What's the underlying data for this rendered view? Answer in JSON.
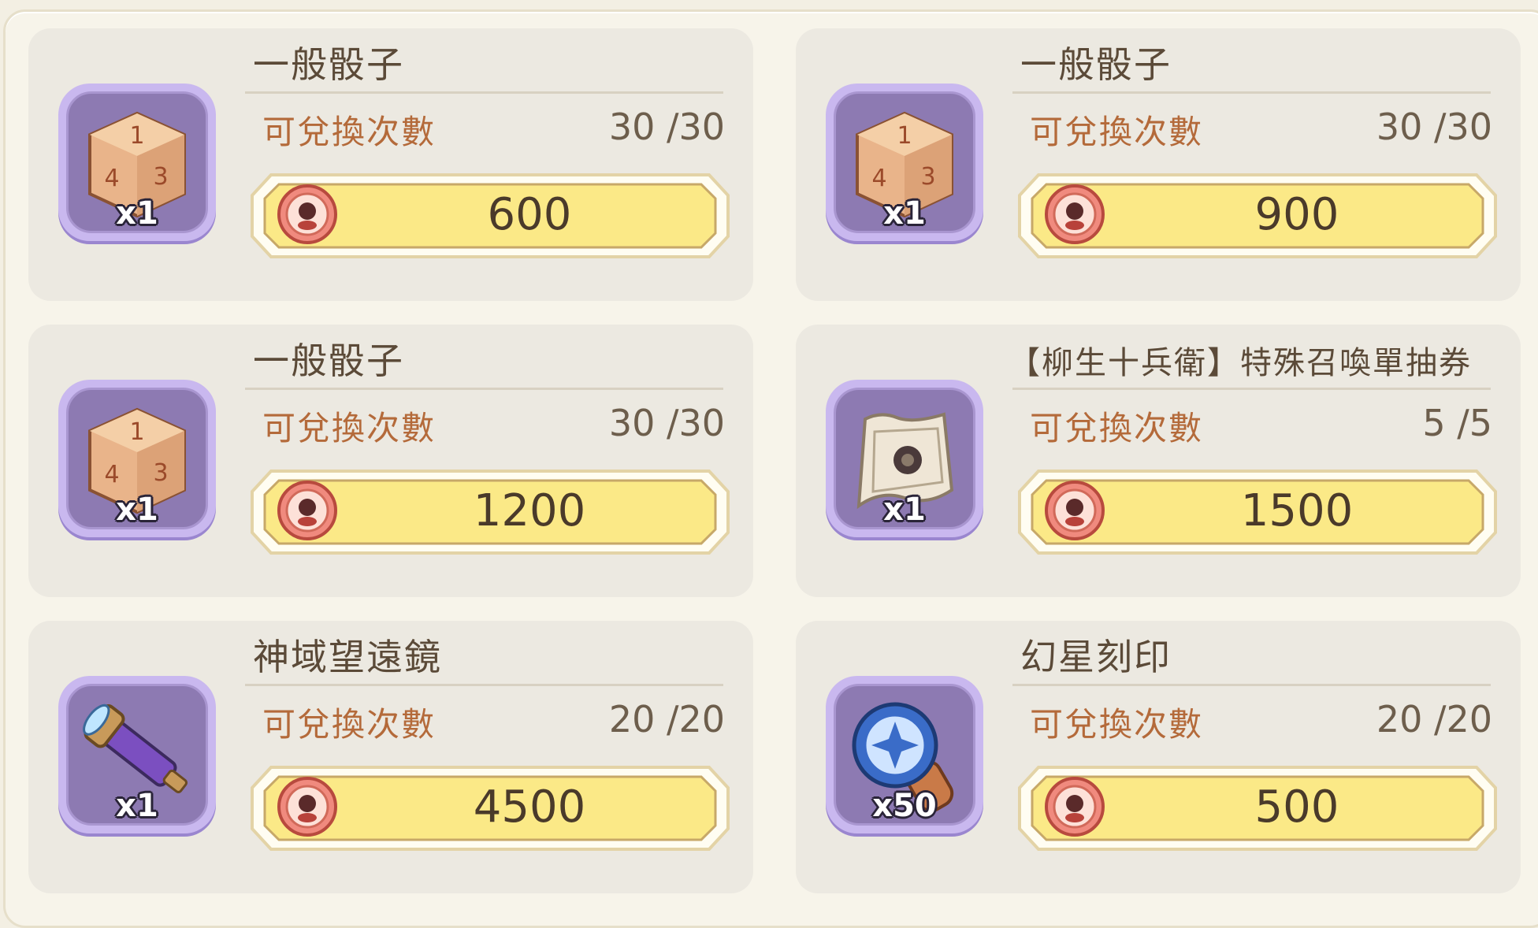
{
  "exchange_label": "可兌換次數",
  "items": [
    {
      "name": "一般骰子",
      "quantity": "x1",
      "remaining": "30 /30",
      "price": "600",
      "icon": "dice-icon"
    },
    {
      "name": "一般骰子",
      "quantity": "x1",
      "remaining": "30 /30",
      "price": "900",
      "icon": "dice-icon"
    },
    {
      "name": "一般骰子",
      "quantity": "x1",
      "remaining": "30 /30",
      "price": "1200",
      "icon": "dice-icon"
    },
    {
      "name": "【柳生十兵衛】特殊召喚單抽券",
      "quantity": "x1",
      "remaining": "5 /5",
      "price": "1500",
      "icon": "summon-ticket-icon"
    },
    {
      "name": "神域望遠鏡",
      "quantity": "x1",
      "remaining": "20 /20",
      "price": "4500",
      "icon": "telescope-icon"
    },
    {
      "name": "幻星刻印",
      "quantity": "x50",
      "remaining": "20 /20",
      "price": "500",
      "icon": "star-seal-icon"
    }
  ],
  "currency_icon": "coin-icon",
  "colors": {
    "card_bg": "#ece9e1",
    "icon_frame": "#8d7ab2",
    "button_fill": "#fbe987",
    "label_orange": "#b46a3a"
  }
}
